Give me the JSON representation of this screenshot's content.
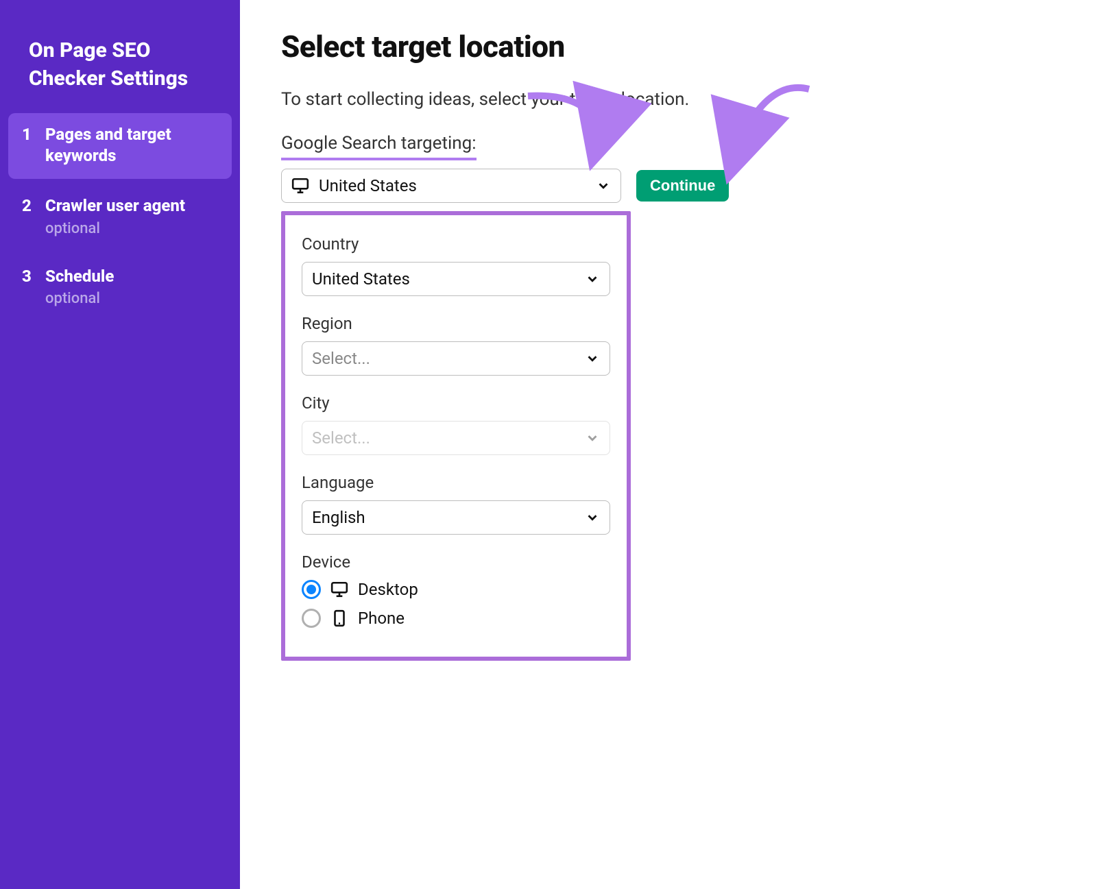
{
  "sidebar": {
    "title": "On Page SEO Checker Settings",
    "items": [
      {
        "num": "1",
        "label": "Pages and target keywords",
        "sublabel": "",
        "active": true
      },
      {
        "num": "2",
        "label": "Crawler user agent",
        "sublabel": "optional",
        "active": false
      },
      {
        "num": "3",
        "label": "Schedule",
        "sublabel": "optional",
        "active": false
      }
    ]
  },
  "main": {
    "title": "Select target location",
    "subtitle": "To start collecting ideas, select your target location.",
    "targeting_label": "Google Search targeting:",
    "select_value": "United States",
    "continue_label": "Continue"
  },
  "panel": {
    "country": {
      "label": "Country",
      "value": "United States"
    },
    "region": {
      "label": "Region",
      "placeholder": "Select..."
    },
    "city": {
      "label": "City",
      "placeholder": "Select..."
    },
    "language": {
      "label": "Language",
      "value": "English"
    },
    "device": {
      "label": "Device",
      "options": [
        {
          "label": "Desktop",
          "checked": true,
          "icon": "desktop"
        },
        {
          "label": "Phone",
          "checked": false,
          "icon": "phone"
        }
      ]
    }
  },
  "colors": {
    "sidebar_bg": "#5a29c4",
    "sidebar_active_bg": "#7c4be0",
    "highlight_border": "#ab6dd9",
    "continue_bg": "#009e73",
    "radio_checked": "#0a84ff"
  }
}
